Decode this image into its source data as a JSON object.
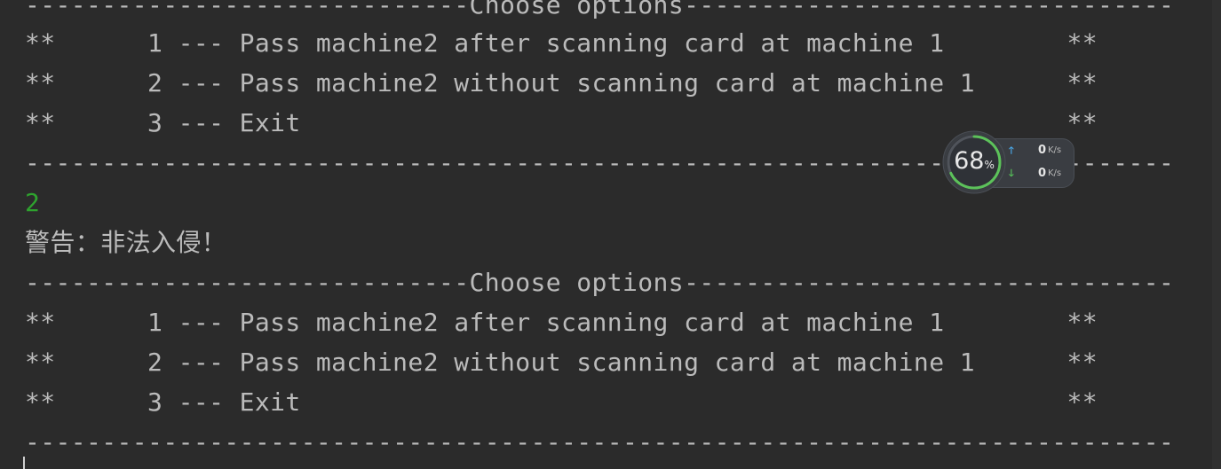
{
  "console": {
    "lines": [
      "-----------------------------Choose options--------------------------------",
      "**      1 --- Pass machine2 after scanning card at machine 1        **",
      "**      2 --- Pass machine2 without scanning card at machine 1      **",
      "**      3 --- Exit                                                  **",
      "---------------------------------------------------------------------------",
      "2",
      "警告：非法入侵！",
      "-----------------------------Choose options--------------------------------",
      "**      1 --- Pass machine2 after scanning card at machine 1        **",
      "**      2 --- Pass machine2 without scanning card at machine 1      **",
      "**      3 --- Exit                                                  **",
      "---------------------------------------------------------------------------"
    ],
    "colors": {
      "background": "#2b2b2b",
      "text": "#bbbbbb",
      "user_input": "#2ea32e"
    }
  },
  "widget": {
    "percent_value": "68",
    "percent_sign": "%",
    "usage_fraction": 0.68,
    "upload_icon": "arrow-up-icon",
    "download_icon": "arrow-down-icon",
    "upload_value": "0",
    "upload_unit": "K/s",
    "download_value": "0",
    "download_unit": "K/s"
  }
}
